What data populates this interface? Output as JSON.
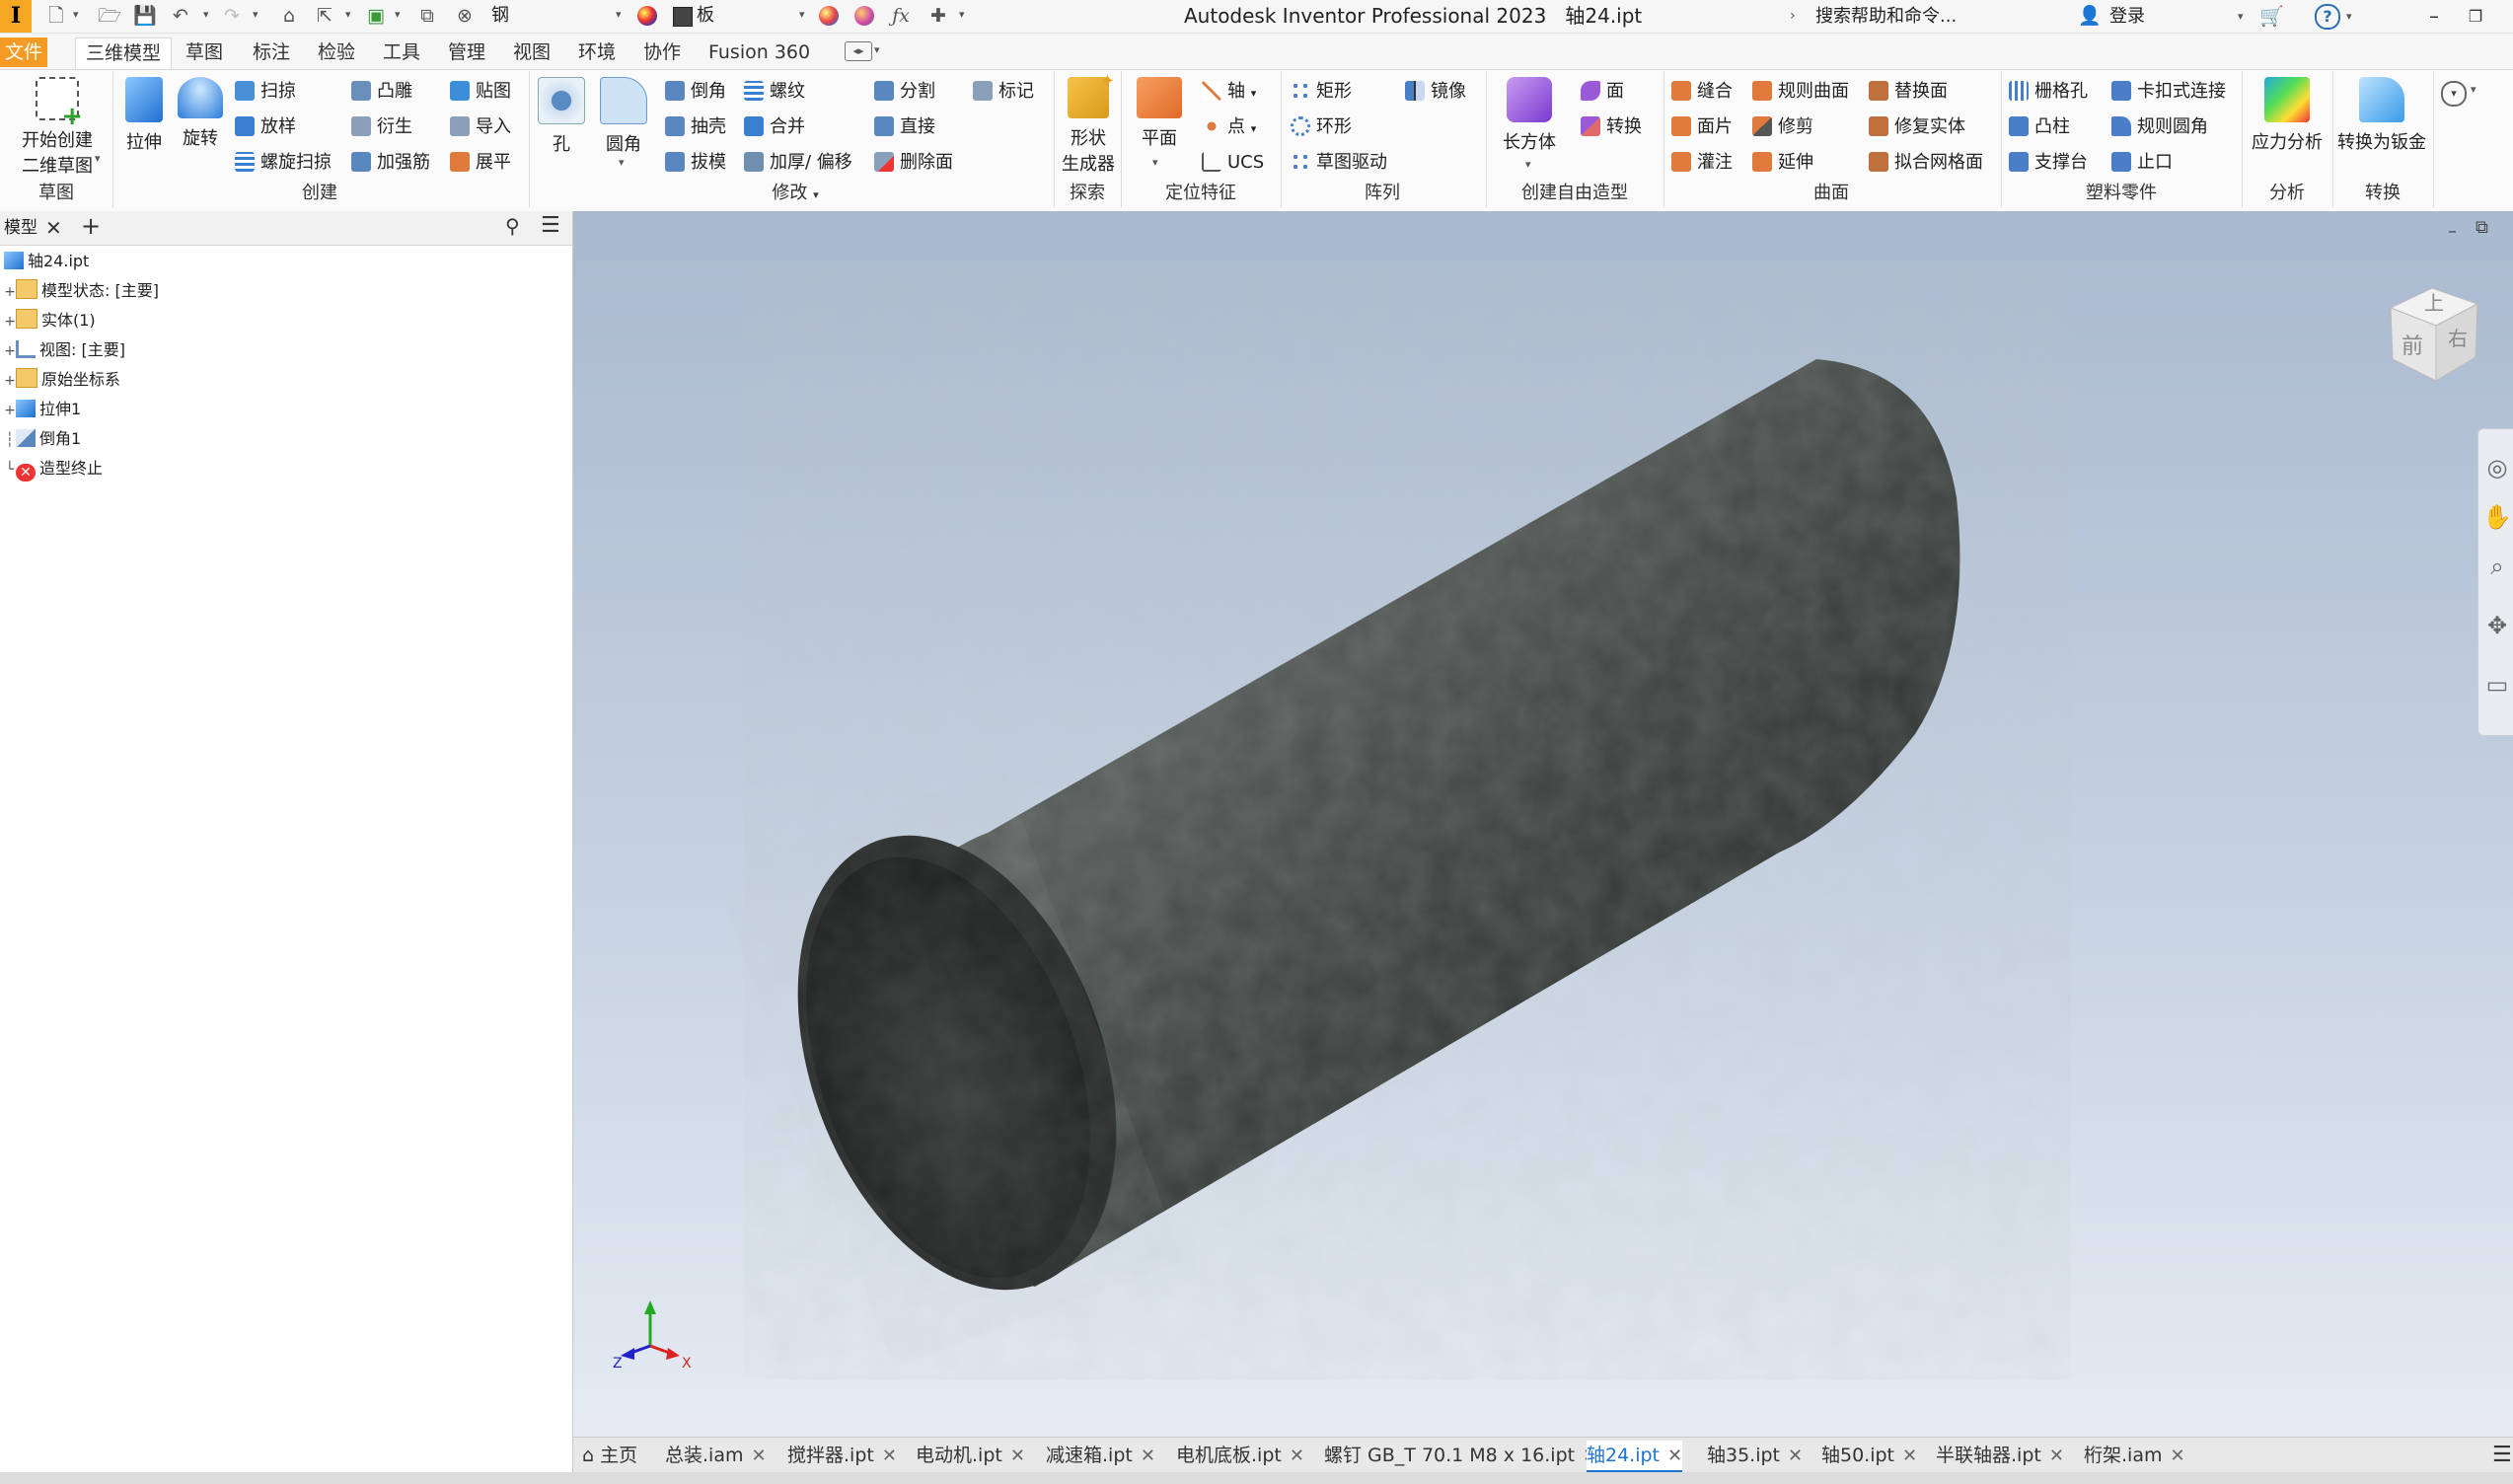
{
  "titlebar": {
    "logo": "I",
    "material": "钢",
    "appearance": "板",
    "app_title": "Autodesk Inventor Professional 2023",
    "doc_title": "轴24.ipt",
    "search": "搜索帮助和命令...",
    "login": "登录"
  },
  "menu": {
    "tabs": [
      "文件",
      "三维模型",
      "草图",
      "标注",
      "检验",
      "工具",
      "管理",
      "视图",
      "环境",
      "协作",
      "Fusion 360"
    ],
    "active": "三维模型"
  },
  "ribbon": {
    "sketch": {
      "start_sketch_1": "开始创建",
      "start_sketch_2": "二维草图",
      "label": "草图"
    },
    "create": {
      "extrude": "拉伸",
      "revolve": "旋转",
      "sweep": "扫掠",
      "loft": "放样",
      "coil": "螺旋扫掠",
      "emboss": "凸雕",
      "derive": "衍生",
      "rib": "加强筋",
      "decal": "贴图",
      "import": "导入",
      "unfold": "展平",
      "label": "创建"
    },
    "modify": {
      "hole": "孔",
      "fillet": "圆角",
      "chamfer": "倒角",
      "shell": "抽壳",
      "draft": "拔模",
      "thread": "螺纹",
      "combine": "合并",
      "thicken": "加厚/ 偏移",
      "split": "分割",
      "direct": "直接",
      "delete_face": "删除面",
      "label": "修改"
    },
    "explore": {
      "shape_gen_1": "形状",
      "shape_gen_2": "生成器",
      "label": "探索",
      "mark": "标记"
    },
    "work": {
      "plane": "平面",
      "axis": "轴",
      "point": "点",
      "ucs": "UCS",
      "label": "定位特征"
    },
    "pattern": {
      "rect": "矩形",
      "circ": "环形",
      "sketch_driven": "草图驱动",
      "mirror": "镜像",
      "label": "阵列"
    },
    "freeform": {
      "box": "长方体",
      "face": "面",
      "convert": "转换",
      "label": "创建自由造型"
    },
    "surface": {
      "stitch": "缝合",
      "patch": "面片",
      "sculpt": "灌注",
      "ruled": "规则曲面",
      "trim": "修剪",
      "extend": "延伸",
      "replace": "替换面",
      "repair": "修复实体",
      "mesh": "拟合网格面",
      "label": "曲面"
    },
    "plastic": {
      "grill": "栅格孔",
      "boss": "凸柱",
      "rest": "支撑台",
      "snap": "卡扣式连接",
      "rule_fillet": "规则圆角",
      "lip": "止口",
      "label": "塑料零件"
    },
    "analysis": {
      "stress": "应力分析",
      "label": "分析"
    },
    "convert": {
      "sheetmetal": "转换为钣金",
      "label": "转换"
    }
  },
  "browser": {
    "tab": "模型",
    "items": [
      {
        "label": "轴24.ipt"
      },
      {
        "label": "模型状态: [主要]"
      },
      {
        "label": "实体(1)"
      },
      {
        "label": "视图: [主要]"
      },
      {
        "label": "原始坐标系"
      },
      {
        "label": "拉伸1"
      },
      {
        "label": "倒角1"
      },
      {
        "label": "造型终止"
      }
    ]
  },
  "viewcube": {
    "top": "上",
    "front": "前",
    "right": "右"
  },
  "triad": {
    "x": "X",
    "y": "Y",
    "z": "Z"
  },
  "doc_tabs": {
    "home": "主页",
    "tabs": [
      "总装.iam",
      "搅拌器.ipt",
      "电动机.ipt",
      "减速箱.ipt",
      "电机底板.ipt",
      "螺钉 GB_T 70.1 M8 x 16.ipt",
      "轴24.ipt",
      "轴35.ipt",
      "轴50.ipt",
      "半联轴器.ipt",
      "桁架.iam"
    ],
    "active": "轴24.ipt"
  },
  "colors": {
    "accent": "#f59a23",
    "active_tab": "#1e74d0"
  }
}
